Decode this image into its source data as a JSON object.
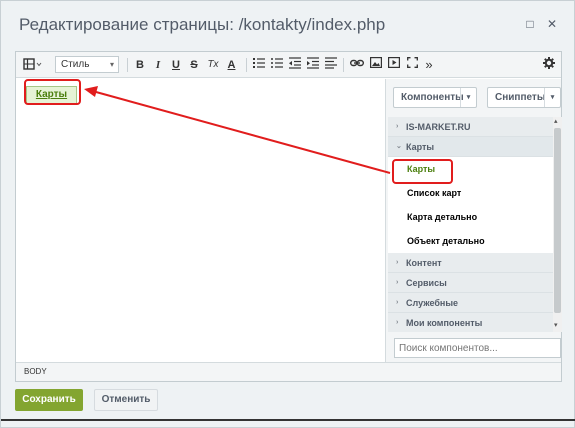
{
  "window": {
    "title": "Редактирование страницы: /kontakty/index.php",
    "minimize_icon": "□",
    "close_icon": "✕"
  },
  "toolbar": {
    "style_label": "Стиль",
    "bold": "B",
    "italic": "I",
    "underline": "U",
    "strike": "S",
    "clear_format": "Tx",
    "font_color": "A",
    "more": "»"
  },
  "content": {
    "component_label": "Карты"
  },
  "panel": {
    "components_button": "Компоненты",
    "snippets_button": "Сниппеты",
    "categories": [
      {
        "label": "IS-MARKET.RU",
        "arrow": "›"
      },
      {
        "label": "Карты",
        "arrow": "⌄"
      }
    ],
    "items": [
      {
        "label": "Карты"
      },
      {
        "label": "Список карт"
      },
      {
        "label": "Карта детально"
      },
      {
        "label": "Объект детально"
      }
    ],
    "categories_bottom": [
      {
        "label": "Контент",
        "arrow": "›"
      },
      {
        "label": "Сервисы",
        "arrow": "›"
      },
      {
        "label": "Служебные",
        "arrow": "›"
      },
      {
        "label": "Мои компоненты",
        "arrow": "›"
      }
    ],
    "search_placeholder": "Поиск компонентов..."
  },
  "statusbar": {
    "path": "BODY"
  },
  "buttons": {
    "save": "Сохранить",
    "cancel": "Отменить"
  },
  "colors": {
    "accent_green": "#83a530",
    "highlight_red": "#e11d1d",
    "selected_item": "#4b7f0d"
  }
}
